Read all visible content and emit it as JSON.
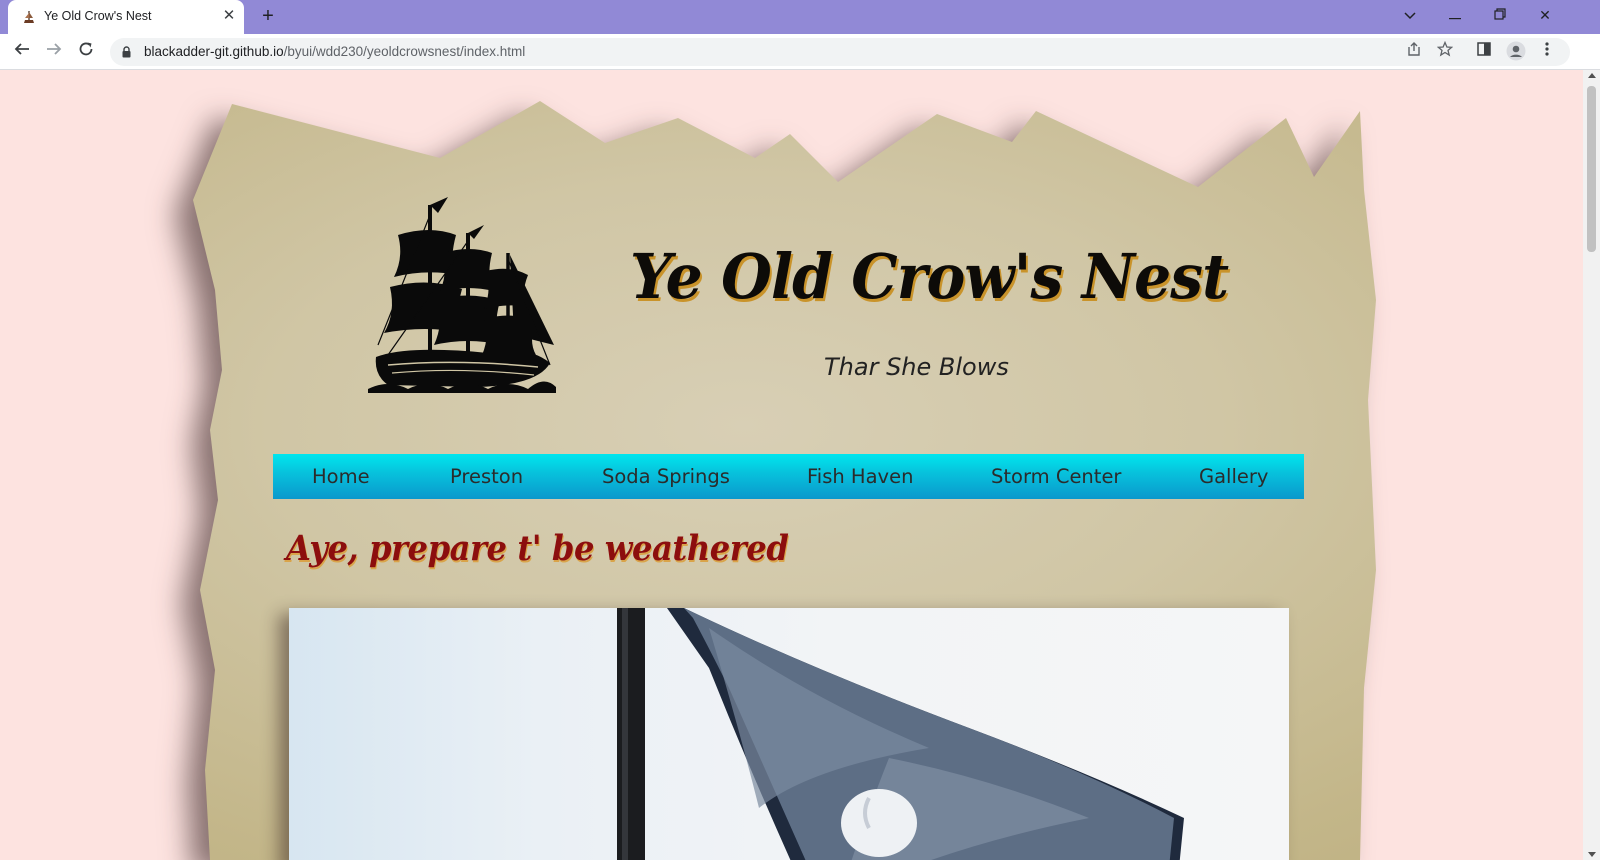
{
  "browser": {
    "tab_title": "Ye Old Crow's Nest",
    "url_host": "blackadder-git.github.io",
    "url_path": "/byui/wdd230/yeoldcrowsnest/index.html",
    "titlebar_color": "#9189d6"
  },
  "site": {
    "title": "Ye Old Crow's Nest",
    "tagline": "Thar She Blows",
    "logo_icon": "pirate-ship-icon",
    "background_color": "#fde3e0"
  },
  "nav": {
    "items": [
      {
        "label": "Home"
      },
      {
        "label": "Preston"
      },
      {
        "label": "Soda Springs"
      },
      {
        "label": "Fish Haven"
      },
      {
        "label": "Storm Center"
      },
      {
        "label": "Gallery"
      }
    ]
  },
  "main": {
    "headline": "Aye, prepare t' be weathered",
    "hero_image": "pirate-flag-photo"
  }
}
